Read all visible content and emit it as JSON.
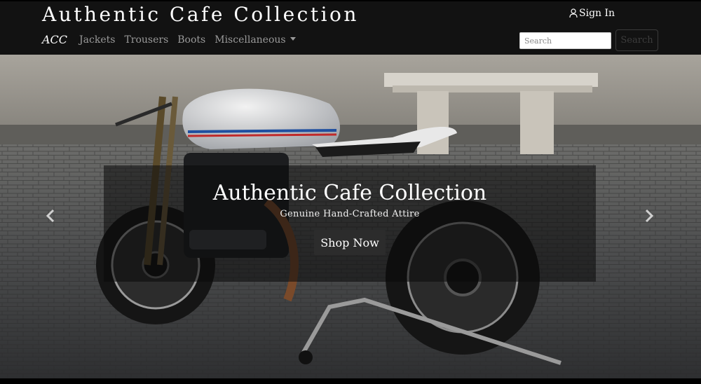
{
  "header": {
    "brand": "Authentic Cafe Collection",
    "sign_in": "Sign In"
  },
  "nav": {
    "short_brand": "ACC",
    "links": [
      "Jackets",
      "Trousers",
      "Boots",
      "Miscellaneous"
    ]
  },
  "search": {
    "placeholder": "Search",
    "button_label": "Search"
  },
  "hero": {
    "title": "Authentic Cafe Collection",
    "subtitle": "Genuine Hand-Crafted Attire",
    "cta_label": "Shop Now"
  },
  "icons": {
    "sign_in": "person-icon",
    "dropdown": "caret-down-icon",
    "prev": "chevron-left-icon",
    "next": "chevron-right-icon"
  },
  "colors": {
    "navbar": "#121212",
    "nav_link": "#9a9a9a",
    "cta_bg": "#2c2c2c",
    "caption_overlay": "rgba(10,10,10,0.55)"
  }
}
